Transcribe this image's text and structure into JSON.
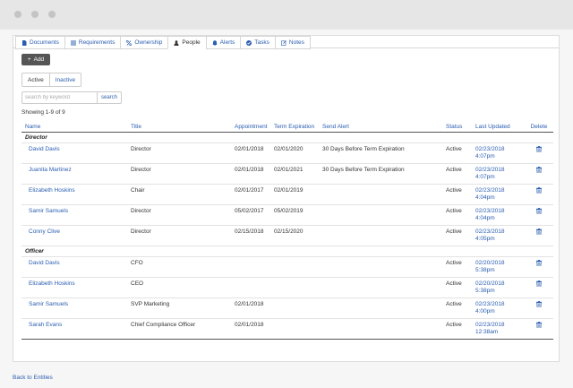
{
  "tabs": [
    {
      "label": "Documents",
      "icon": "document-icon"
    },
    {
      "label": "Requirements",
      "icon": "list-icon"
    },
    {
      "label": "Ownership",
      "icon": "percent-icon"
    },
    {
      "label": "People",
      "icon": "user-icon"
    },
    {
      "label": "Alerts",
      "icon": "bell-icon"
    },
    {
      "label": "Tasks",
      "icon": "check-circle-icon"
    },
    {
      "label": "Notes",
      "icon": "edit-icon"
    }
  ],
  "active_tab": "People",
  "add_button": {
    "label": "Add"
  },
  "filter": {
    "active_label": "Active",
    "inactive_label": "Inactive"
  },
  "search": {
    "placeholder": "search by keyword",
    "button_label": "search"
  },
  "showing": "Showing 1-9 of 9",
  "table": {
    "headers": {
      "name": "Name",
      "title": "Title",
      "appointment": "Appointment",
      "term": "Term Expiration",
      "alert": "Send Alert",
      "status": "Status",
      "updated": "Last Updated",
      "delete": "Delete"
    },
    "groups": [
      {
        "label": "Director",
        "rows": [
          {
            "name": "David Davis",
            "title": "Director",
            "appointment": "02/01/2018",
            "term": "02/01/2020",
            "alert": "30 Days Before Term Expiration",
            "status": "Active",
            "updated_date": "02/23/2018",
            "updated_time": "4:07pm"
          },
          {
            "name": "Juanita Martinez",
            "title": "Director",
            "appointment": "02/01/2018",
            "term": "02/01/2021",
            "alert": "30 Days Before Term Expiration",
            "status": "Active",
            "updated_date": "02/23/2018",
            "updated_time": "4:07pm"
          },
          {
            "name": "Elizabeth Hoskins",
            "title": "Chair",
            "appointment": "02/01/2017",
            "term": "02/01/2019",
            "alert": "",
            "status": "Active",
            "updated_date": "02/23/2018",
            "updated_time": "4:04pm"
          },
          {
            "name": "Samir Samuels",
            "title": "Director",
            "appointment": "05/02/2017",
            "term": "05/02/2019",
            "alert": "",
            "status": "Active",
            "updated_date": "02/23/2018",
            "updated_time": "4:04pm"
          },
          {
            "name": "Conny Clive",
            "title": "Director",
            "appointment": "02/15/2018",
            "term": "02/15/2020",
            "alert": "",
            "status": "Active",
            "updated_date": "02/23/2018",
            "updated_time": "4:05pm"
          }
        ]
      },
      {
        "label": "Officer",
        "rows": [
          {
            "name": "David Davis",
            "title": "CFO",
            "appointment": "",
            "term": "",
            "alert": "",
            "status": "Active",
            "updated_date": "02/20/2018",
            "updated_time": "5:38pm"
          },
          {
            "name": "Elizabeth Hoskins",
            "title": "CEO",
            "appointment": "",
            "term": "",
            "alert": "",
            "status": "Active",
            "updated_date": "02/20/2018",
            "updated_time": "5:38pm"
          },
          {
            "name": "Samir Samuels",
            "title": "SVP Marketing",
            "appointment": "02/01/2018",
            "term": "",
            "alert": "",
            "status": "Active",
            "updated_date": "02/23/2018",
            "updated_time": "4:00pm"
          },
          {
            "name": "Sarah Evans",
            "title": "Chief Compliance Officer",
            "appointment": "02/01/2018",
            "term": "",
            "alert": "",
            "status": "Active",
            "updated_date": "02/23/2018",
            "updated_time": "12:38am"
          }
        ]
      }
    ]
  },
  "back_link": "Back to Entities",
  "colors": {
    "link": "#2a5db0",
    "add_button": "#555555"
  }
}
